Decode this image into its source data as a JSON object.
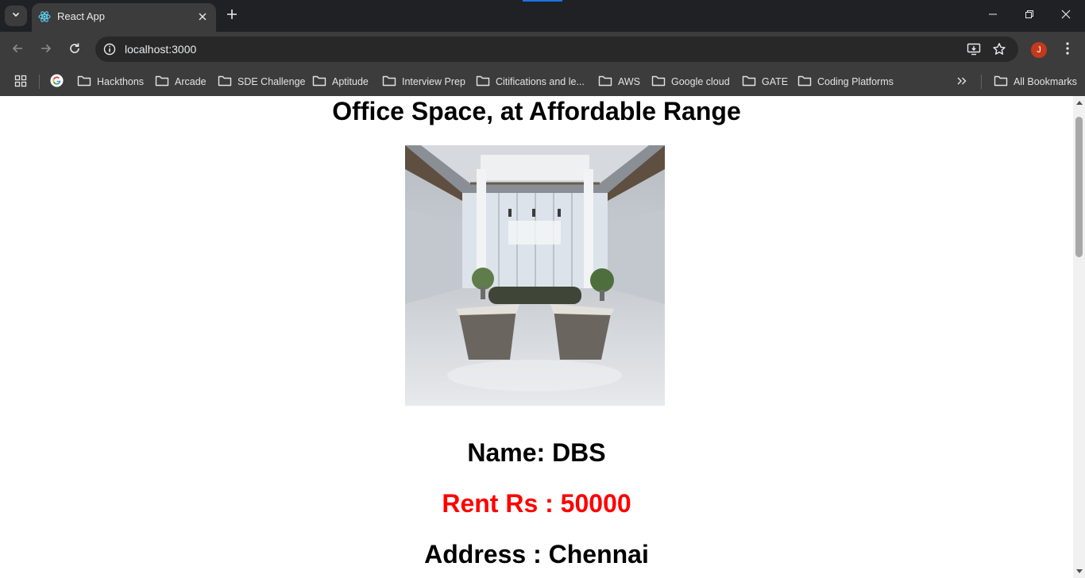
{
  "browser": {
    "tab": {
      "title": "React App"
    },
    "url": "localhost:3000",
    "profile_initial": "J",
    "bookmarks": [
      {
        "label": "Hackthons"
      },
      {
        "label": "Arcade"
      },
      {
        "label": "SDE Challenge"
      },
      {
        "label": "Aptitude"
      },
      {
        "label": "Interview Prep"
      },
      {
        "label": "Citifications and le..."
      },
      {
        "label": "AWS"
      },
      {
        "label": "Google cloud"
      },
      {
        "label": "GATE"
      },
      {
        "label": "Coding Platforms"
      }
    ],
    "all_bookmarks_label": "All Bookmarks"
  },
  "page": {
    "title": "Office Space, at Affordable Range",
    "name_line": "Name: DBS",
    "rent_line": "Rent Rs : 50000",
    "address_line": "Address : Chennai",
    "rent_color": "#ff0000"
  },
  "icons": {
    "tab_search": "chevron-down-icon",
    "favicon": "react-icon",
    "tab_close": "close-icon",
    "new_tab": "plus-icon",
    "back": "back-arrow-icon",
    "forward": "forward-arrow-icon",
    "reload": "reload-icon",
    "site_info": "info-icon",
    "install": "install-app-icon",
    "bookmark_star": "star-icon",
    "menu": "kebab-menu-icon",
    "apps": "apps-grid-icon",
    "google": "google-icon",
    "folder": "folder-icon",
    "overflow": "double-chevron-icon"
  }
}
